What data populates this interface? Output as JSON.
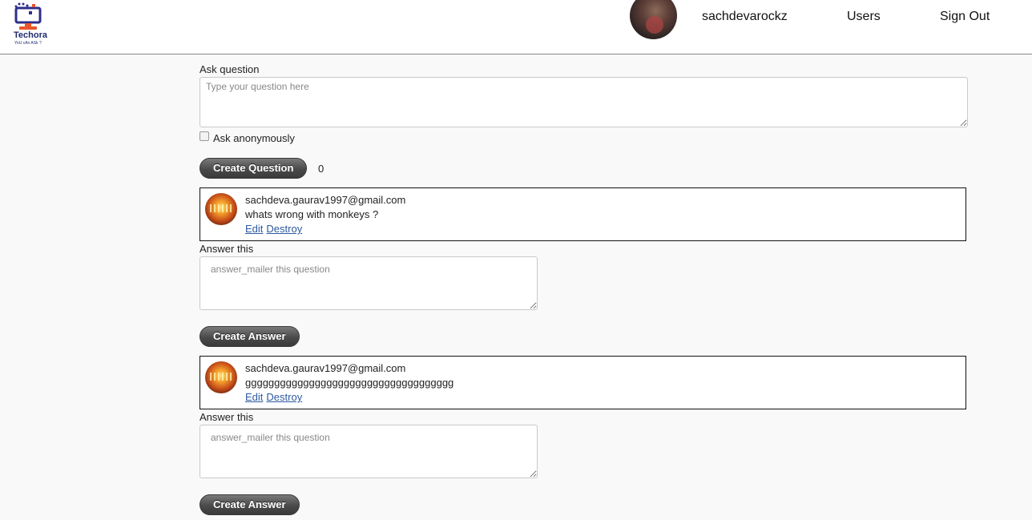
{
  "header": {
    "logo_text": "Techora",
    "logo_tagline": "YoU cAn ASk ?",
    "username": "sachdevarockz",
    "nav": {
      "users": "Users",
      "sign_out": "Sign Out"
    }
  },
  "ask": {
    "label": "Ask question",
    "placeholder": "Type your question here",
    "anonymous_label": "Ask anonymously",
    "create_button": "Create Question",
    "count": "0"
  },
  "questions": [
    {
      "email": "sachdeva.gaurav1997@gmail.com",
      "text": "whats wrong with monkeys ?",
      "edit": "Edit",
      "destroy": "Destroy",
      "answer_label": "Answer this",
      "answer_placeholder": "answer_mailer this question",
      "answer_button": "Create Answer"
    },
    {
      "email": "sachdeva.gaurav1997@gmail.com",
      "text": "gggggggggggggggggggggggggggggggggggg",
      "edit": "Edit",
      "destroy": "Destroy",
      "answer_label": "Answer this",
      "answer_placeholder": "answer_mailer this question",
      "answer_button": "Create Answer"
    }
  ]
}
